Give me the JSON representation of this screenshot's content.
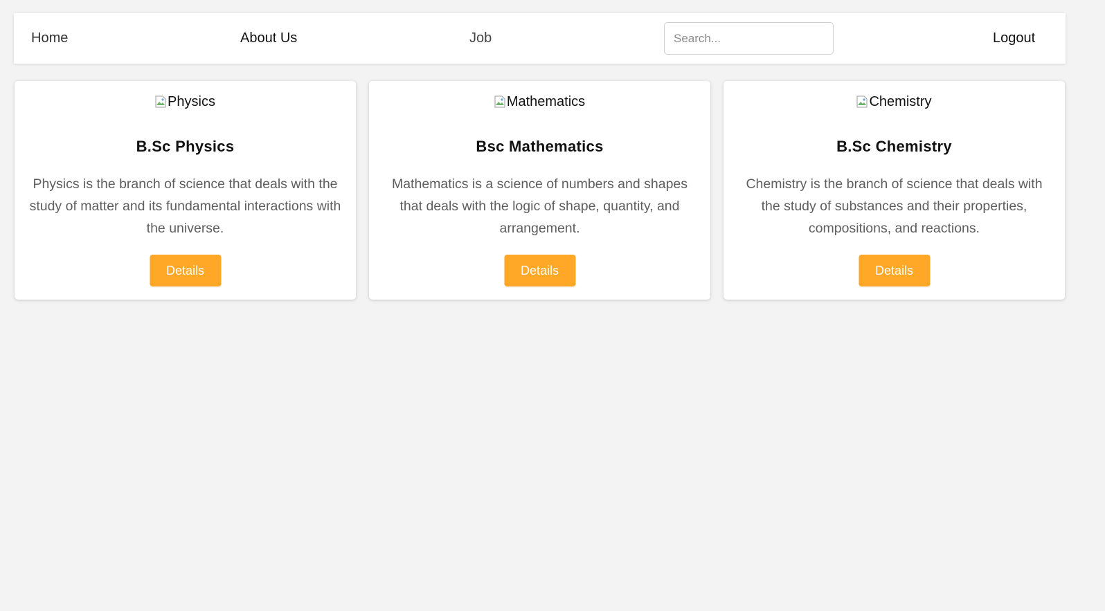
{
  "nav": {
    "home": "Home",
    "about": "About Us",
    "job": "Job",
    "search_placeholder": "Search...",
    "logout": "Logout"
  },
  "theme": {
    "accent": "#ffa726",
    "background": "#f3f3f3",
    "card_background": "#ffffff"
  },
  "cards": [
    {
      "image_alt": "Physics",
      "title": "B.Sc Physics",
      "description": "Physics is the branch of science that deals with the study of matter and its fundamental interactions with the universe.",
      "button_label": "Details"
    },
    {
      "image_alt": "Mathematics",
      "title": "Bsc Mathematics",
      "description": "Mathematics is a science of numbers and shapes that deals with the logic of shape, quantity, and arrangement.",
      "button_label": "Details"
    },
    {
      "image_alt": "Chemistry",
      "title": "B.Sc Chemistry",
      "description": "Chemistry is the branch of science that deals with the study of substances and their properties, compositions, and reactions.",
      "button_label": "Details"
    }
  ]
}
